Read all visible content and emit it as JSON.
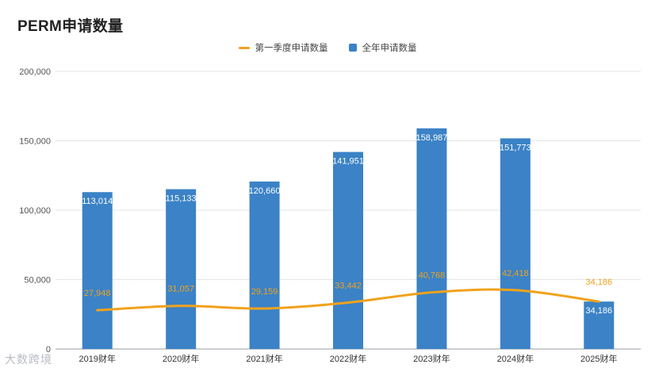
{
  "title": "PERM申请数量",
  "watermark": "大数跨境",
  "colors": {
    "bar": "#3b82c6",
    "line": "#f0a21c",
    "line_label": "#f0a21c",
    "bar_label": "#ffffff",
    "grid": "#e3e5e8",
    "axis_text": "#555555"
  },
  "chart_data": {
    "type": "bar",
    "title": "PERM申请数量",
    "categories": [
      "2019财年",
      "2020财年",
      "2021财年",
      "2022财年",
      "2023财年",
      "2024财年",
      "2025财年"
    ],
    "series": [
      {
        "name": "全年申请数量",
        "type": "bar",
        "values": [
          113014,
          115133,
          120660,
          141951,
          158987,
          151773,
          34186
        ],
        "labels": [
          "113,014",
          "115,133",
          "120,660",
          "141,951",
          "158,987",
          "151,773",
          "34,186"
        ]
      },
      {
        "name": "第一季度申请数量",
        "type": "line",
        "values": [
          27948,
          31057,
          29159,
          33442,
          40768,
          42418,
          34186
        ],
        "labels": [
          "27,948",
          "31,057",
          "29,159",
          "33,442",
          "40,768",
          "42,418",
          "34,186"
        ]
      }
    ],
    "ylim": [
      0,
      200000
    ],
    "yticks": [
      0,
      50000,
      100000,
      150000,
      200000
    ],
    "ytick_labels": [
      "0",
      "50,000",
      "100,000",
      "150,000",
      "200,000"
    ],
    "xlabel": "",
    "ylabel": "",
    "grid": true,
    "legend_position": "top-center"
  }
}
